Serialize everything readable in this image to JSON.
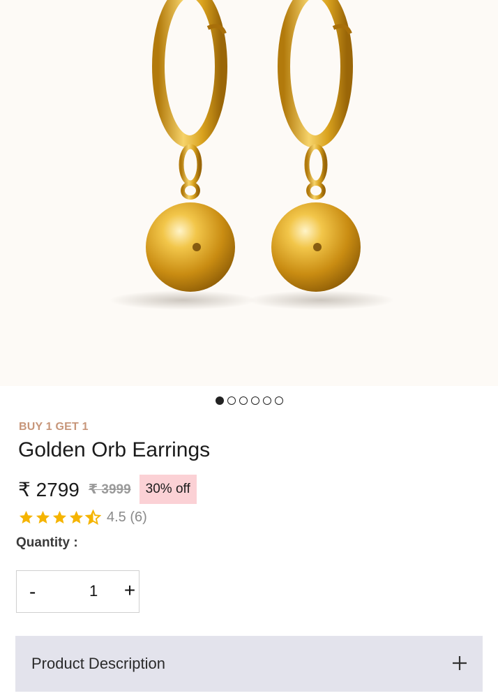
{
  "product": {
    "image_alt": "Gold hoop earrings with ball drops",
    "gallery_count": 6,
    "gallery_active_index": 0,
    "promo_label": "BUY 1 GET 1",
    "name": "Golden Orb Earrings",
    "price": "₹ 2799",
    "mrp": "₹ 3999",
    "discount": "30% off",
    "rating_value": 4.5,
    "rating_text": "4.5 (6)",
    "star_color": "#f5b400"
  },
  "quantity": {
    "label": "Quantity :",
    "decrement_label": "-",
    "value": "1",
    "increment_label": "+"
  },
  "description": {
    "label": "Product Description"
  },
  "colors": {
    "promo": "#c7967a",
    "discount_bg": "#fbd1d5",
    "accordion_bg": "#e3e3ec",
    "gold": "#d9a21e"
  }
}
